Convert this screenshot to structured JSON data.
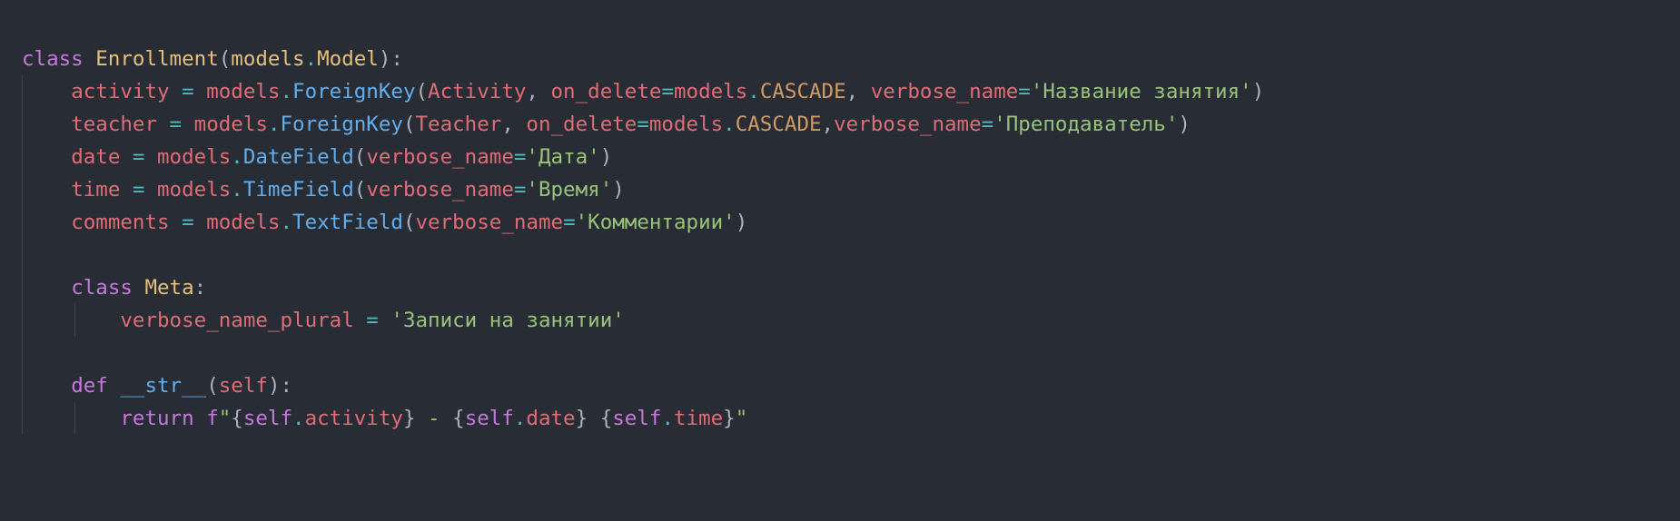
{
  "editor": {
    "language": "python",
    "theme_colors": {
      "background": "#282c34",
      "keyword": "#c678dd",
      "class_name": "#e5c07b",
      "variable": "#e06c75",
      "operator": "#56b6c2",
      "function": "#61afef",
      "constant": "#d19a66",
      "string": "#98c379",
      "punctuation": "#abb2bf"
    },
    "lines": [
      [
        {
          "t": "class",
          "c": "kw"
        },
        {
          "t": " ",
          "c": "plain"
        },
        {
          "t": "Enrollment",
          "c": "cls"
        },
        {
          "t": "(",
          "c": "punc"
        },
        {
          "t": "models",
          "c": "cls"
        },
        {
          "t": ".",
          "c": "op"
        },
        {
          "t": "Model",
          "c": "cls"
        },
        {
          "t": "):",
          "c": "punc"
        }
      ],
      [
        {
          "t": "    ",
          "c": "plain"
        },
        {
          "t": "activity",
          "c": "var"
        },
        {
          "t": " = ",
          "c": "op"
        },
        {
          "t": "models",
          "c": "var"
        },
        {
          "t": ".",
          "c": "op"
        },
        {
          "t": "ForeignKey",
          "c": "fn"
        },
        {
          "t": "(",
          "c": "punc"
        },
        {
          "t": "Activity",
          "c": "var"
        },
        {
          "t": ", ",
          "c": "punc"
        },
        {
          "t": "on_delete",
          "c": "var"
        },
        {
          "t": "=",
          "c": "op"
        },
        {
          "t": "models",
          "c": "var"
        },
        {
          "t": ".",
          "c": "op"
        },
        {
          "t": "CASCADE",
          "c": "const"
        },
        {
          "t": ", ",
          "c": "punc"
        },
        {
          "t": "verbose_name",
          "c": "var"
        },
        {
          "t": "=",
          "c": "op"
        },
        {
          "t": "'Название занятия'",
          "c": "str"
        },
        {
          "t": ")",
          "c": "punc"
        }
      ],
      [
        {
          "t": "    ",
          "c": "plain"
        },
        {
          "t": "teacher",
          "c": "var"
        },
        {
          "t": " = ",
          "c": "op"
        },
        {
          "t": "models",
          "c": "var"
        },
        {
          "t": ".",
          "c": "op"
        },
        {
          "t": "ForeignKey",
          "c": "fn"
        },
        {
          "t": "(",
          "c": "punc"
        },
        {
          "t": "Teacher",
          "c": "var"
        },
        {
          "t": ", ",
          "c": "punc"
        },
        {
          "t": "on_delete",
          "c": "var"
        },
        {
          "t": "=",
          "c": "op"
        },
        {
          "t": "models",
          "c": "var"
        },
        {
          "t": ".",
          "c": "op"
        },
        {
          "t": "CASCADE",
          "c": "const"
        },
        {
          "t": ",",
          "c": "punc"
        },
        {
          "t": "verbose_name",
          "c": "var"
        },
        {
          "t": "=",
          "c": "op"
        },
        {
          "t": "'Преподаватель'",
          "c": "str"
        },
        {
          "t": ")",
          "c": "punc"
        }
      ],
      [
        {
          "t": "    ",
          "c": "plain"
        },
        {
          "t": "date",
          "c": "var"
        },
        {
          "t": " = ",
          "c": "op"
        },
        {
          "t": "models",
          "c": "var"
        },
        {
          "t": ".",
          "c": "op"
        },
        {
          "t": "DateField",
          "c": "fn"
        },
        {
          "t": "(",
          "c": "punc"
        },
        {
          "t": "verbose_name",
          "c": "var"
        },
        {
          "t": "=",
          "c": "op"
        },
        {
          "t": "'Дата'",
          "c": "str"
        },
        {
          "t": ")",
          "c": "punc"
        }
      ],
      [
        {
          "t": "    ",
          "c": "plain"
        },
        {
          "t": "time",
          "c": "var"
        },
        {
          "t": " = ",
          "c": "op"
        },
        {
          "t": "models",
          "c": "var"
        },
        {
          "t": ".",
          "c": "op"
        },
        {
          "t": "TimeField",
          "c": "fn"
        },
        {
          "t": "(",
          "c": "punc"
        },
        {
          "t": "verbose_name",
          "c": "var"
        },
        {
          "t": "=",
          "c": "op"
        },
        {
          "t": "'Время'",
          "c": "str"
        },
        {
          "t": ")",
          "c": "punc"
        }
      ],
      [
        {
          "t": "    ",
          "c": "plain"
        },
        {
          "t": "comments",
          "c": "var"
        },
        {
          "t": " = ",
          "c": "op"
        },
        {
          "t": "models",
          "c": "var"
        },
        {
          "t": ".",
          "c": "op"
        },
        {
          "t": "TextField",
          "c": "fn"
        },
        {
          "t": "(",
          "c": "punc"
        },
        {
          "t": "verbose_name",
          "c": "var"
        },
        {
          "t": "=",
          "c": "op"
        },
        {
          "t": "'Комментарии'",
          "c": "str"
        },
        {
          "t": ")",
          "c": "punc"
        }
      ],
      [],
      [
        {
          "t": "    ",
          "c": "plain"
        },
        {
          "t": "class",
          "c": "kw"
        },
        {
          "t": " ",
          "c": "plain"
        },
        {
          "t": "Meta",
          "c": "cls"
        },
        {
          "t": ":",
          "c": "punc"
        }
      ],
      [
        {
          "t": "        ",
          "c": "plain"
        },
        {
          "t": "verbose_name_plural",
          "c": "var"
        },
        {
          "t": " = ",
          "c": "op"
        },
        {
          "t": "'Записи на занятии'",
          "c": "str"
        }
      ],
      [],
      [
        {
          "t": "    ",
          "c": "plain"
        },
        {
          "t": "def",
          "c": "kw"
        },
        {
          "t": " ",
          "c": "plain"
        },
        {
          "t": "__str__",
          "c": "fn"
        },
        {
          "t": "(",
          "c": "punc"
        },
        {
          "t": "self",
          "c": "var"
        },
        {
          "t": "):",
          "c": "punc"
        }
      ],
      [
        {
          "t": "        ",
          "c": "plain"
        },
        {
          "t": "return",
          "c": "kw"
        },
        {
          "t": " ",
          "c": "plain"
        },
        {
          "t": "f",
          "c": "kw"
        },
        {
          "t": "\"",
          "c": "str"
        },
        {
          "t": "{",
          "c": "punc"
        },
        {
          "t": "self",
          "c": "kw"
        },
        {
          "t": ".",
          "c": "op"
        },
        {
          "t": "activity",
          "c": "var"
        },
        {
          "t": "}",
          "c": "punc"
        },
        {
          "t": " - ",
          "c": "str"
        },
        {
          "t": "{",
          "c": "punc"
        },
        {
          "t": "self",
          "c": "kw"
        },
        {
          "t": ".",
          "c": "op"
        },
        {
          "t": "date",
          "c": "var"
        },
        {
          "t": "}",
          "c": "punc"
        },
        {
          "t": " ",
          "c": "str"
        },
        {
          "t": "{",
          "c": "punc"
        },
        {
          "t": "self",
          "c": "kw"
        },
        {
          "t": ".",
          "c": "op"
        },
        {
          "t": "time",
          "c": "var"
        },
        {
          "t": "}",
          "c": "punc"
        },
        {
          "t": "\"",
          "c": "str"
        }
      ]
    ]
  }
}
